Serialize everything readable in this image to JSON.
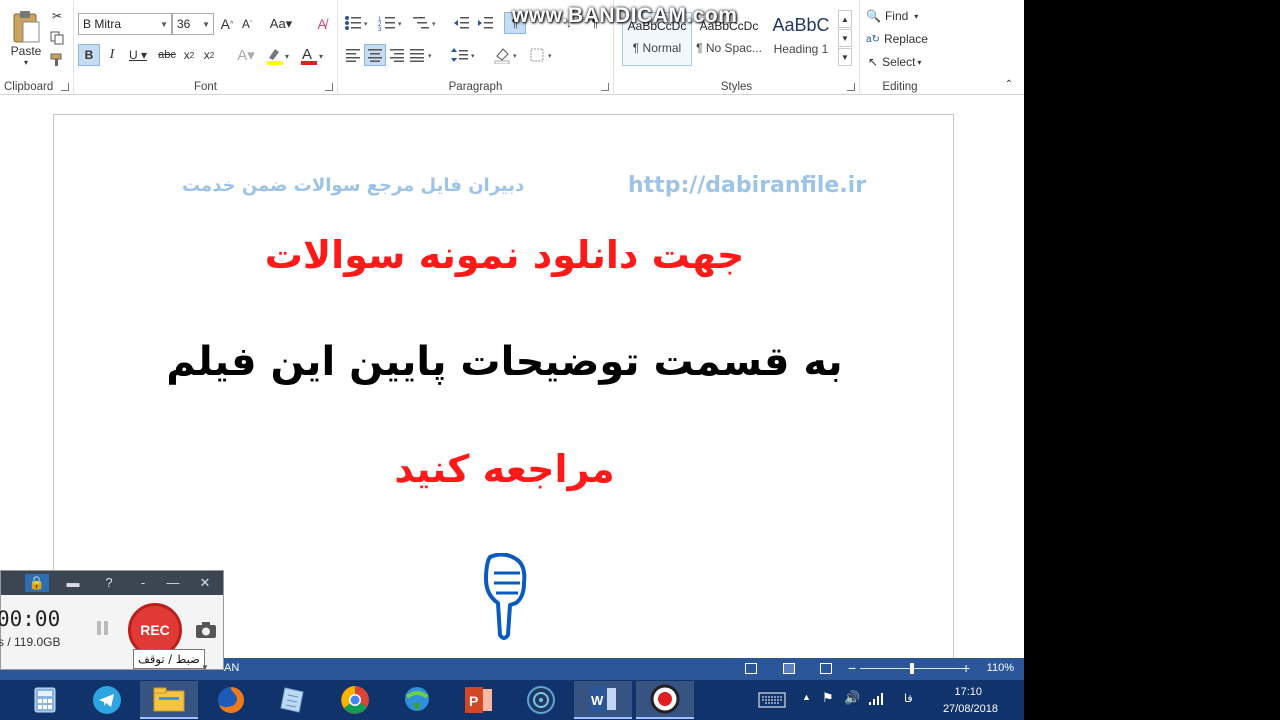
{
  "watermark": "www.BANDICAM.com",
  "ribbon": {
    "clipboard": {
      "label": "Clipboard",
      "paste_label": "Paste"
    },
    "font": {
      "label": "Font",
      "family": "B Mitra",
      "size": "36"
    },
    "paragraph": {
      "label": "Paragraph"
    },
    "styles": {
      "label": "Styles",
      "items": [
        {
          "sample": "AaBbCcDc",
          "name": "¶ Normal"
        },
        {
          "sample": "AaBbCcDc",
          "name": "¶ No Spac..."
        },
        {
          "sample": "AaBbC",
          "name": "Heading 1"
        }
      ]
    },
    "editing": {
      "label": "Editing",
      "find": "Find",
      "replace": "Replace",
      "select": "Select"
    }
  },
  "document": {
    "header_fa": "دبیران فایل مرجع سوالات ضمن خدمت",
    "header_url": "http://dabiranfile.ir",
    "line1": "جهت دانلود نمونه سوالات",
    "line2": "به قسمت توضیحات پایین این فیلم",
    "line3": "مراجعه کنید"
  },
  "statusbar": {
    "language": "AN",
    "zoom": "110%"
  },
  "bandicam": {
    "time": "00:00",
    "size": "s / 119.0GB",
    "rec_label": "REC",
    "tooltip": "ضبط / توقف"
  },
  "taskbar": {
    "apps": [
      "calculator-icon",
      "telegram-icon",
      "file-explorer-icon",
      "firefox-icon",
      "notepad-icon",
      "chrome-icon",
      "idm-icon",
      "powerpoint-icon",
      "media-player-icon",
      "word-icon",
      "bandicam-icon"
    ],
    "keyboard_lang": "فا",
    "time": "17:10",
    "date": "27/08/2018"
  },
  "colors": {
    "red_text": "#ff1a1a",
    "header_blue": "#9dc3e6",
    "statusbar": "#2b579a",
    "taskbar": "#10336b"
  }
}
